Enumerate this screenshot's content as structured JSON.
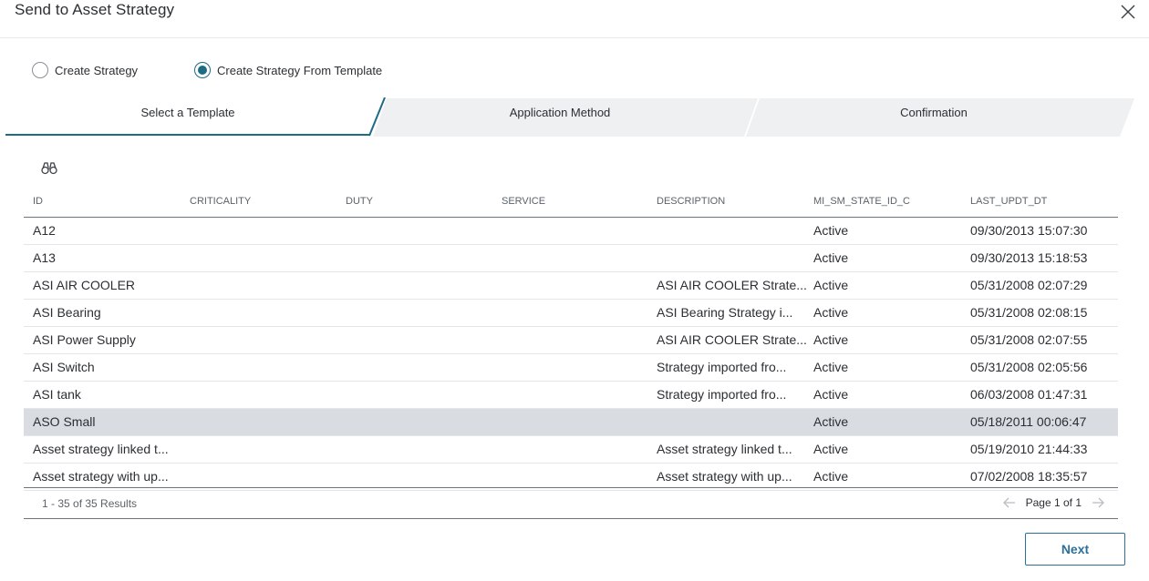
{
  "dialog": {
    "title": "Send to Asset Strategy"
  },
  "options": [
    {
      "label": "Create Strategy",
      "selected": false
    },
    {
      "label": "Create Strategy From Template",
      "selected": true
    }
  ],
  "steps": [
    {
      "label": "Select a Template",
      "active": true
    },
    {
      "label": "Application Method",
      "active": false
    },
    {
      "label": "Confirmation",
      "active": false
    }
  ],
  "toolbar": {
    "search_icon": "binoculars-icon"
  },
  "table": {
    "columns": [
      "ID",
      "CRITICALITY",
      "DUTY",
      "SERVICE",
      "DESCRIPTION",
      "MI_SM_STATE_ID_C",
      "LAST_UPDT_DT"
    ],
    "rows": [
      {
        "id": "A12",
        "criticality": "",
        "duty": "",
        "service": "",
        "description": "",
        "state": "Active",
        "updated": "09/30/2013 15:07:30"
      },
      {
        "id": "A13",
        "criticality": "",
        "duty": "",
        "service": "",
        "description": "",
        "state": "Active",
        "updated": "09/30/2013 15:18:53"
      },
      {
        "id": "ASI AIR COOLER",
        "criticality": "",
        "duty": "",
        "service": "",
        "description": "ASI AIR COOLER Strate...",
        "state": "Active",
        "updated": "05/31/2008 02:07:29"
      },
      {
        "id": "ASI Bearing",
        "criticality": "",
        "duty": "",
        "service": "",
        "description": "ASI Bearing Strategy i...",
        "state": "Active",
        "updated": "05/31/2008 02:08:15"
      },
      {
        "id": "ASI Power Supply",
        "criticality": "",
        "duty": "",
        "service": "",
        "description": "ASI AIR COOLER Strate...",
        "state": "Active",
        "updated": "05/31/2008 02:07:55"
      },
      {
        "id": "ASI Switch",
        "criticality": "",
        "duty": "",
        "service": "",
        "description": "Strategy imported fro...",
        "state": "Active",
        "updated": "05/31/2008 02:05:56"
      },
      {
        "id": "ASI tank",
        "criticality": "",
        "duty": "",
        "service": "",
        "description": "Strategy imported fro...",
        "state": "Active",
        "updated": "06/03/2008 01:47:31"
      },
      {
        "id": "ASO Small",
        "criticality": "",
        "duty": "",
        "service": "",
        "description": "",
        "state": "Active",
        "updated": "05/18/2011 00:06:47",
        "selected": true
      },
      {
        "id": "Asset strategy linked t...",
        "criticality": "",
        "duty": "",
        "service": "",
        "description": "Asset strategy linked t...",
        "state": "Active",
        "updated": "05/19/2010 21:44:33"
      },
      {
        "id": "Asset strategy with up...",
        "criticality": "",
        "duty": "",
        "service": "",
        "description": "Asset strategy with up...",
        "state": "Active",
        "updated": "07/02/2008 18:35:57"
      }
    ]
  },
  "pagination": {
    "results_text": "1 - 35 of 35 Results",
    "page_text": "Page 1 of 1"
  },
  "actions": {
    "next_label": "Next"
  },
  "colors": {
    "accent": "#1d6b85",
    "button": "#2f6f9a",
    "selected_row": "#d9dde2",
    "step_inactive": "#eef0f2"
  }
}
